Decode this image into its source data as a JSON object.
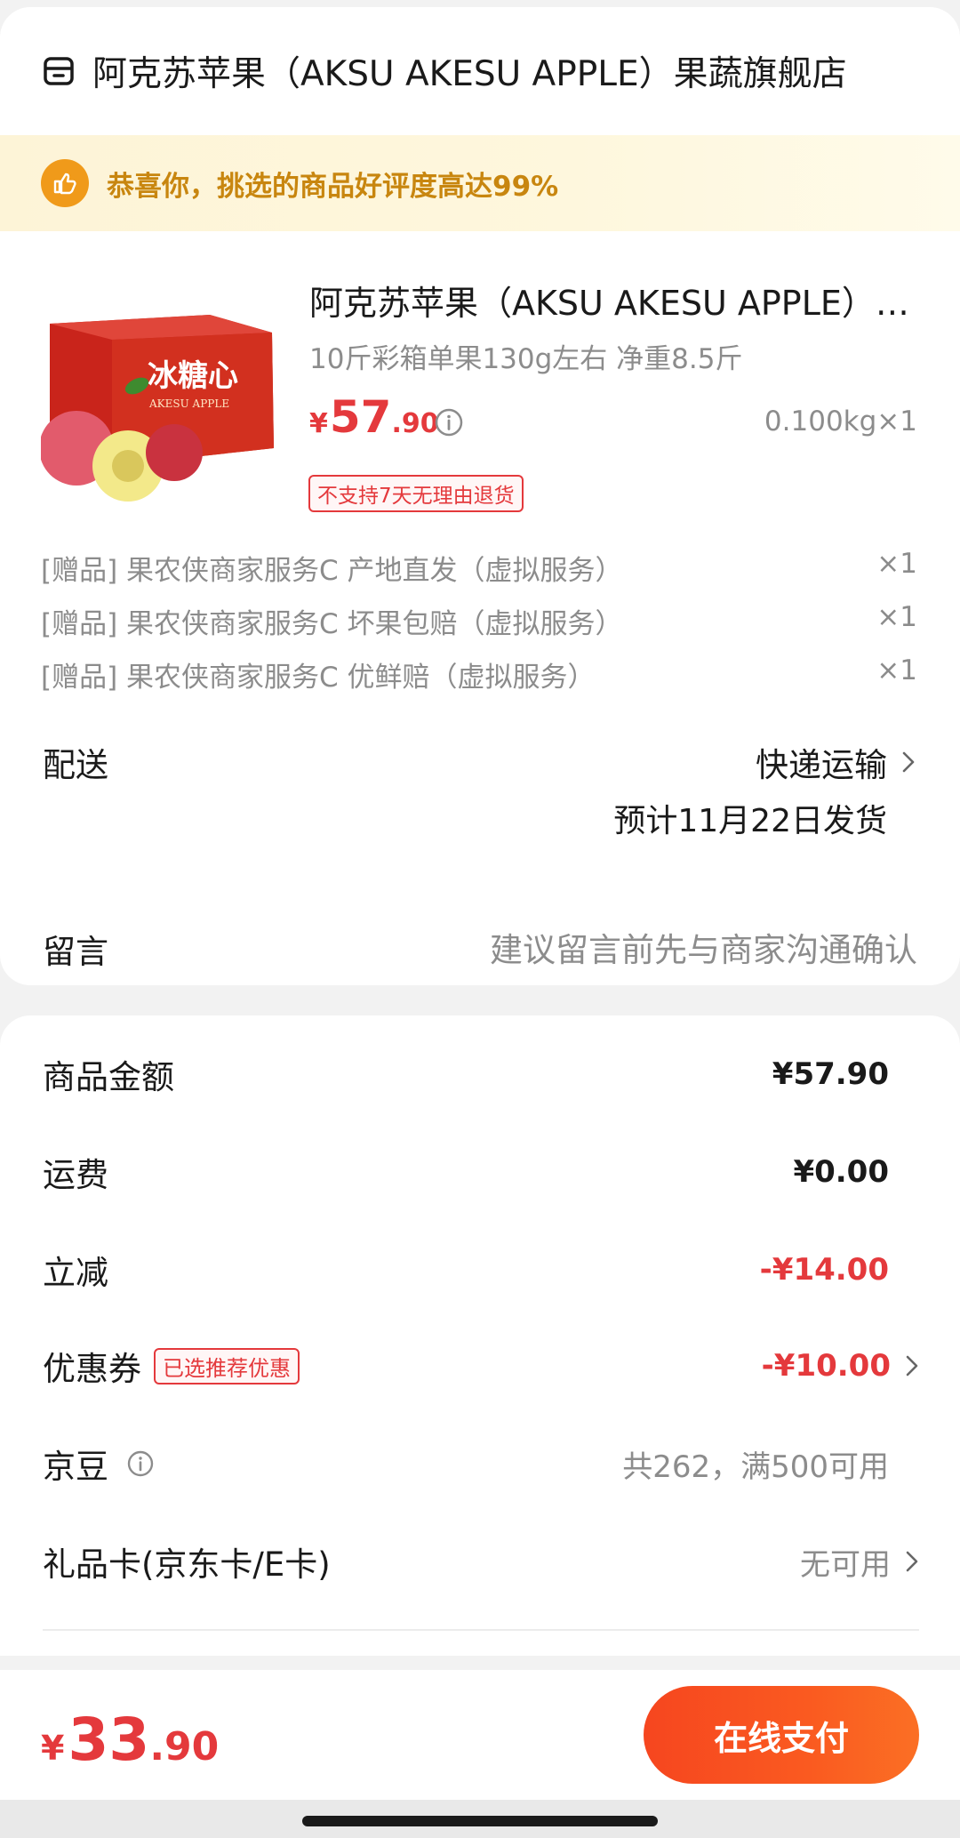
{
  "store": {
    "name": "阿克苏苹果（AKSU AKESU APPLE）果蔬旗舰店",
    "icon": "store-icon"
  },
  "banner": {
    "text": "恭喜你，挑选的商品好评度高达99%",
    "icon": "thumbs-up-icon"
  },
  "product": {
    "title": "阿克苏苹果（AKSU AKESU APPLE）冰糖心",
    "spec": "10斤彩箱单果130g左右 净重8.5斤",
    "price_symbol": "¥",
    "price_int": "57",
    "price_dec": ".90",
    "quantity": "0.100kg×1",
    "tag": "不支持7天无理由退货",
    "image_box_text": "冰糖心",
    "image_box_sub": "AKESU APPLE"
  },
  "gifts": [
    {
      "label": "[赠品] 果农侠商家服务C 产地直发（虚拟服务）",
      "qty": "×1"
    },
    {
      "label": "[赠品] 果农侠商家服务C 坏果包赔（虚拟服务）",
      "qty": "×1"
    },
    {
      "label": "[赠品] 果农侠商家服务C 优鲜赔（虚拟服务）",
      "qty": "×1"
    }
  ],
  "shipping": {
    "label": "配送",
    "method": "快递运输",
    "date": "预计11月22日发货"
  },
  "message": {
    "label": "留言",
    "placeholder": "建议留言前先与商家沟通确认"
  },
  "summary": {
    "goods_label": "商品金额",
    "goods_value": "¥57.90",
    "freight_label": "运费",
    "freight_value": "¥0.00",
    "discount_label": "立减",
    "discount_value": "-¥14.00",
    "coupon_label": "优惠券",
    "coupon_tag": "已选推荐优惠",
    "coupon_value": "-¥10.00",
    "jdbean_label": "京豆",
    "jdbean_value": "共262，满500可用",
    "giftcard_label": "礼品卡(京东卡/E卡)",
    "giftcard_value": "无可用"
  },
  "footer": {
    "total_symbol": "¥",
    "total_int": "33",
    "total_dec": ".90",
    "pay_label": "在线支付"
  },
  "colors": {
    "accent_red": "#e4393c",
    "pay_orange": "#f6461f",
    "banner_gold": "#c8860f"
  }
}
